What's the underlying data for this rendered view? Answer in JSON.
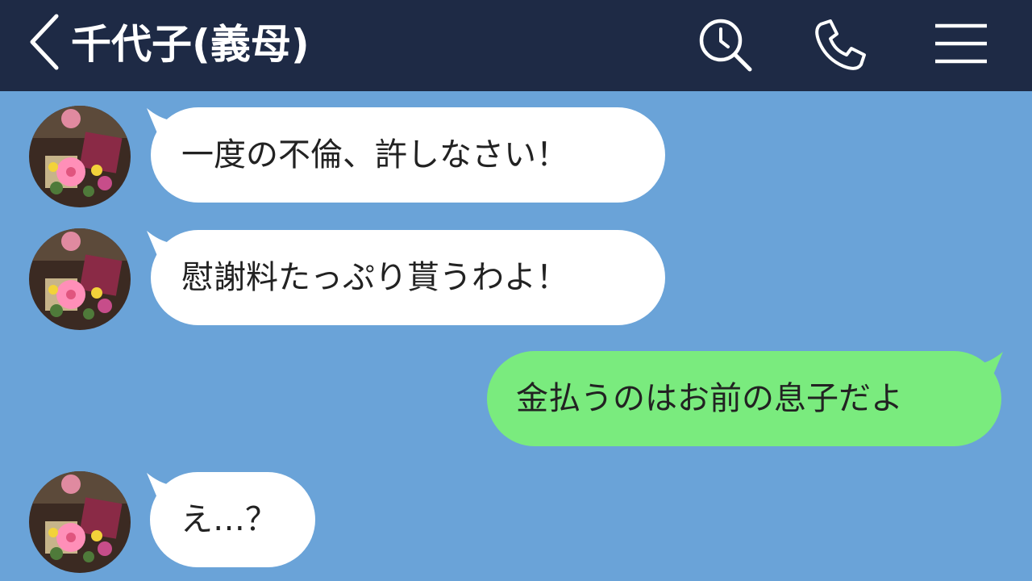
{
  "header": {
    "contact_name": "千代子(義母)",
    "icons": [
      "back-chevron-icon",
      "search-clock-icon",
      "phone-icon",
      "menu-icon"
    ]
  },
  "messages": [
    {
      "side": "incoming",
      "text": "一度の不倫、許しなさい！"
    },
    {
      "side": "incoming",
      "text": "慰謝料たっぷり貰うわよ！"
    },
    {
      "side": "outgoing",
      "text": "金払うのはお前の息子だよ"
    },
    {
      "side": "incoming",
      "text": "え…？"
    }
  ],
  "colors": {
    "header_bg": "#1e2a45",
    "chat_bg": "#6aa3d8",
    "incoming_bubble": "#ffffff",
    "outgoing_bubble": "#7aeb7e",
    "text": "#222222"
  }
}
